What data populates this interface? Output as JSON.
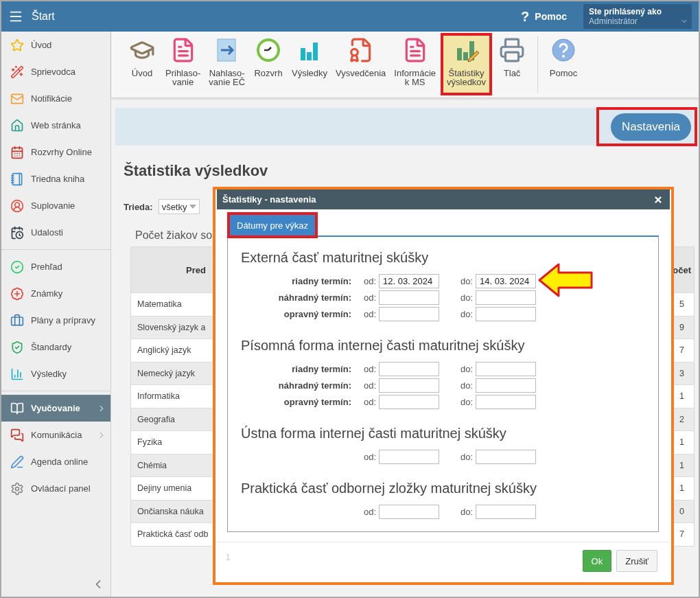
{
  "header": {
    "title": "Štart",
    "help_glyph": "?",
    "help_label": "Pomoc",
    "user_label": "Ste prihlásený ako",
    "user_value": "Administrátor"
  },
  "sidebar": {
    "sections": [
      {
        "items": [
          {
            "label": "Úvod",
            "selected": false,
            "has_submenu": false
          },
          {
            "label": "Sprievodca",
            "selected": false,
            "has_submenu": false
          },
          {
            "label": "Notifikácie",
            "selected": false,
            "has_submenu": false
          },
          {
            "label": "Web stránka",
            "selected": false,
            "has_submenu": false
          },
          {
            "label": "Rozvrhy Online",
            "selected": false,
            "has_submenu": false
          },
          {
            "label": "Triedna kniha",
            "selected": false,
            "has_submenu": false
          },
          {
            "label": "Suplovanie",
            "selected": false,
            "has_submenu": false
          },
          {
            "label": "Udalosti",
            "selected": false,
            "has_submenu": false
          }
        ]
      },
      {
        "items": [
          {
            "label": "Prehľad",
            "selected": false,
            "has_submenu": false
          },
          {
            "label": "Známky",
            "selected": false,
            "has_submenu": false
          },
          {
            "label": "Plány a prípravy",
            "selected": false,
            "has_submenu": false
          },
          {
            "label": "Štandardy",
            "selected": false,
            "has_submenu": false
          },
          {
            "label": "Výsledky",
            "selected": false,
            "has_submenu": false
          }
        ]
      },
      {
        "items": [
          {
            "label": "Vyučovanie",
            "selected": true,
            "has_submenu": true
          },
          {
            "label": "Komunikácia",
            "selected": false,
            "has_submenu": true
          },
          {
            "label": "Agenda online",
            "selected": false,
            "has_submenu": false
          },
          {
            "label": "Ovládací panel",
            "selected": false,
            "has_submenu": false
          }
        ]
      }
    ]
  },
  "toolbar": {
    "items": [
      {
        "label": "Úvod",
        "selected": false,
        "highlighted": false
      },
      {
        "label": "Prihlaso-\nvanie",
        "selected": false,
        "highlighted": false
      },
      {
        "label": "Nahlaso-\nvanie EČ",
        "selected": false,
        "highlighted": false
      },
      {
        "label": "Rozvrh",
        "selected": false,
        "highlighted": false
      },
      {
        "label": "Výsledky",
        "selected": false,
        "highlighted": false
      },
      {
        "label": "Vysvedčenia",
        "selected": false,
        "highlighted": false
      },
      {
        "label": "Informácie\nk MS",
        "selected": false,
        "highlighted": false
      },
      {
        "label": "Štatistiky\nvýsledkov",
        "selected": true,
        "highlighted": true
      },
      {
        "label": "Tlač",
        "selected": false,
        "highlighted": false
      },
      {
        "label": "Pomoc",
        "selected": false,
        "highlighted": false
      }
    ]
  },
  "settings_button": {
    "label": "Nastavenia",
    "highlighted": true
  },
  "page": {
    "title": "Štatistika výsledkov",
    "filter_label": "Trieda:",
    "filter_value": "všetky",
    "table_caption": "Počet žiakov so"
  },
  "table": {
    "columns": [
      "Pred",
      "očet"
    ],
    "rows": [
      {
        "cells": [
          "Matematika",
          "5"
        ]
      },
      {
        "cells": [
          "Slovenský jazyk a",
          "9"
        ]
      },
      {
        "cells": [
          "Anglický jazyk",
          "7"
        ]
      },
      {
        "cells": [
          "Nemecký jazyk",
          "3"
        ]
      },
      {
        "cells": [
          "Informatika",
          "1"
        ]
      },
      {
        "cells": [
          "Geografia",
          "2"
        ]
      },
      {
        "cells": [
          "Fyzika",
          "1"
        ]
      },
      {
        "cells": [
          "Chémia",
          "1"
        ]
      },
      {
        "cells": [
          "Dejiny umenia",
          "1"
        ]
      },
      {
        "cells": [
          "Ončianska náuka",
          "0"
        ]
      },
      {
        "cells": [
          "Praktická časť odb",
          "7"
        ]
      }
    ]
  },
  "dialog": {
    "title": "Štatistiky - nastavenia",
    "tabs": [
      {
        "label": "Dátumy pre výkaz",
        "selected": true,
        "highlighted": true
      }
    ],
    "sections": [
      {
        "title": "Externá časť maturitnej skúšky",
        "rows": [
          {
            "label": "riadny termín:",
            "from_label": "od:",
            "from_value": "12. 03. 2024",
            "to_label": "do:",
            "to_value": "14. 03. 2024",
            "pointer": true
          },
          {
            "label": "náhradný termín:",
            "from_label": "od:",
            "to_label": "do:",
            "pointer": false
          },
          {
            "label": "opravný termín:",
            "from_label": "od:",
            "to_label": "do:",
            "pointer": false
          }
        ]
      },
      {
        "title": "Písomná forma internej časti maturitnej skúšky",
        "rows": [
          {
            "label": "riadny termín:",
            "from_label": "od:",
            "to_label": "do:",
            "pointer": false
          },
          {
            "label": "náhradný termín:",
            "from_label": "od:",
            "to_label": "do:",
            "pointer": false
          },
          {
            "label": "opravný termín:",
            "from_label": "od:",
            "to_label": "do:",
            "pointer": false
          }
        ]
      },
      {
        "title": "Ústna forma internej časti maturitnej skúšky",
        "rows": [
          {
            "from_label": "od:",
            "to_label": "do:",
            "pointer": false
          }
        ]
      },
      {
        "title": "Praktická časť odbornej zložky maturitnej skúšky",
        "rows": [
          {
            "from_label": "od:",
            "to_label": "do:",
            "pointer": false
          }
        ]
      }
    ],
    "page_number": "1",
    "buttons": [
      {
        "label": "Ok",
        "kind": "primary"
      },
      {
        "label": "Zrušiť",
        "kind": "default"
      }
    ]
  }
}
